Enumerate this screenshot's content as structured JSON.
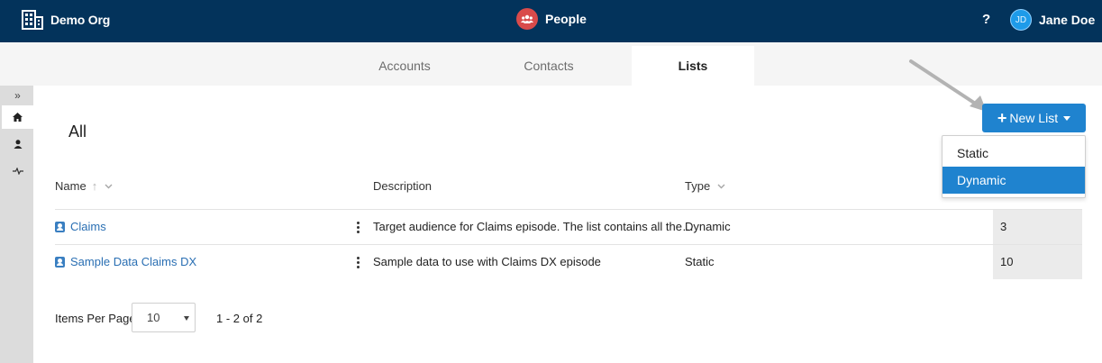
{
  "header": {
    "org_name": "Demo Org",
    "app_name": "People",
    "help_label": "?",
    "user_initials": "JD",
    "user_name": "Jane Doe"
  },
  "tabs": [
    {
      "label": "Accounts",
      "active": false
    },
    {
      "label": "Contacts",
      "active": false
    },
    {
      "label": "Lists",
      "active": true
    }
  ],
  "rail": {
    "expand_glyph": "»",
    "items": [
      "home-icon",
      "person-icon",
      "activity-icon"
    ]
  },
  "main": {
    "heading": "All",
    "new_button_label": "New List",
    "new_button_menu": [
      "Static",
      "Dynamic"
    ],
    "new_button_menu_selected": "Dynamic"
  },
  "table": {
    "columns": [
      "Name",
      "Description",
      "Type"
    ],
    "rows": [
      {
        "name": "Claims",
        "description": "Target audience for Claims episode. The list contains all the…",
        "type": "Dynamic",
        "count": "3"
      },
      {
        "name": "Sample Data Claims DX",
        "description": "Sample data to use with Claims DX episode",
        "type": "Static",
        "count": "10"
      }
    ]
  },
  "pager": {
    "items_per_page_label": "Items Per Page",
    "items_per_page_value": "10",
    "range_text": "1 - 2 of 2"
  },
  "colors": {
    "header_bg": "#03335b",
    "accent": "#1f83cf",
    "app_icon": "#d94b4b",
    "link": "#2a6fb3"
  }
}
